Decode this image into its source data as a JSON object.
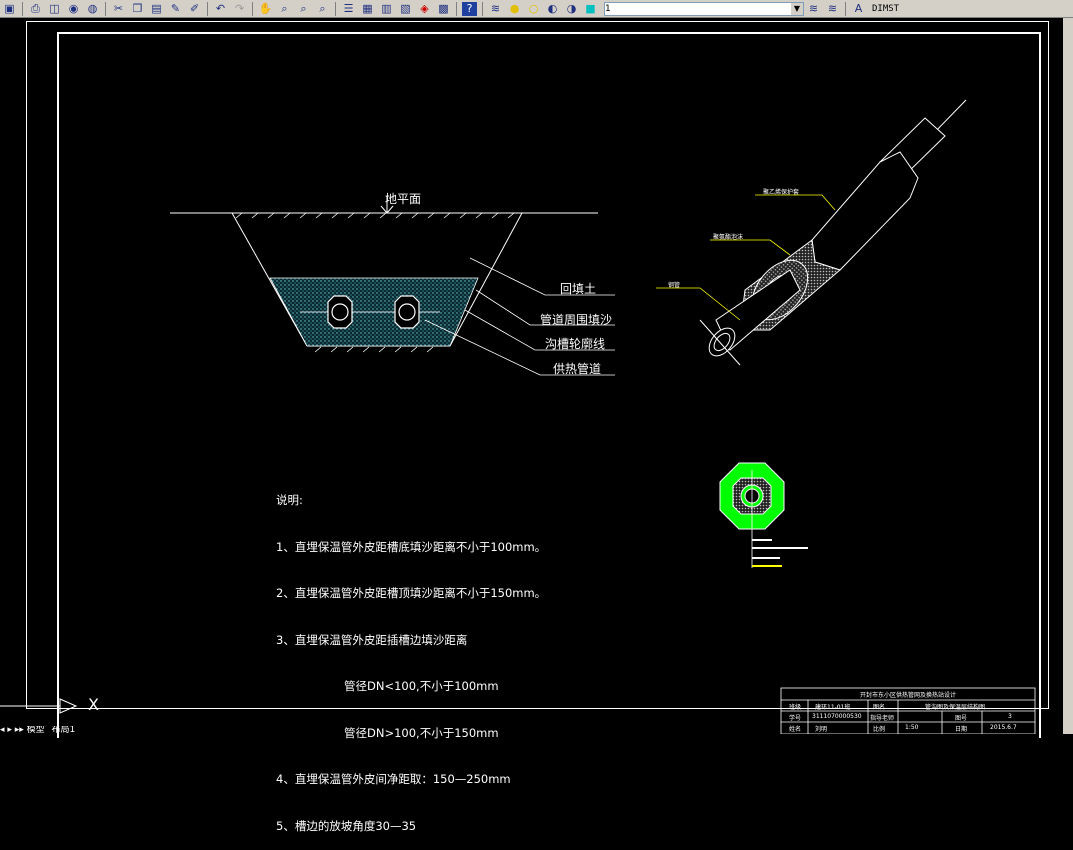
{
  "toolbar": {
    "layer_value": "1",
    "dimstyle": "DIMST",
    "icons": [
      "save-icon",
      "print-icon",
      "preview-icon",
      "plot-icon",
      "publish-icon",
      "cut-icon",
      "copy-icon",
      "paste-icon",
      "matchprop-icon",
      "brush-icon",
      "undo-icon",
      "redo-icon",
      "pan-icon",
      "zoom-realtime-icon",
      "zoom-window-icon",
      "zoom-previous-icon",
      "properties-icon",
      "designcenter-icon",
      "toolpalette-icon",
      "sheetset-icon",
      "markup-icon",
      "calculator-icon",
      "help-icon"
    ]
  },
  "drawing": {
    "ground_label": "地平面",
    "callouts": [
      "回填土",
      "管道周围填沙",
      "沟槽轮廓线",
      "供热管道"
    ],
    "pipe_tags": [
      "聚乙烯保护套",
      "聚氨酯泡沫",
      "钢管"
    ],
    "notes_title": "说明:",
    "notes": [
      "1、直埋保温管外皮距槽底填沙距离不小于100mm。",
      "2、直埋保温管外皮距槽顶填沙距离不小于150mm。",
      "3、直埋保温管外皮距插槽边填沙距离",
      "管径DN<100,不小于100mm",
      "管径DN>100,不小于150mm",
      "4、直埋保温管外皮间净距取：150—250mm",
      "5、槽边的放坡角度30—35"
    ],
    "ucs_label": "X"
  },
  "title_block": {
    "project": "开封市东小区供热管网及换热站设计",
    "row1": [
      "班级",
      "建环11-01班",
      "图名",
      "管沟图及保温层结构图"
    ],
    "row2": [
      "学号",
      "3111070000530",
      "指导老师",
      "",
      "图号",
      "3"
    ],
    "row3": [
      "姓名",
      "刘明",
      "比例",
      "1:50",
      "日期",
      "2015.6.7"
    ]
  },
  "tabs": [
    "模型",
    "布局1"
  ],
  "colors": {
    "insulation_green": "#00ff00",
    "sand_fill": "#5fb8c8",
    "leader_yellow": "#ffff00"
  }
}
